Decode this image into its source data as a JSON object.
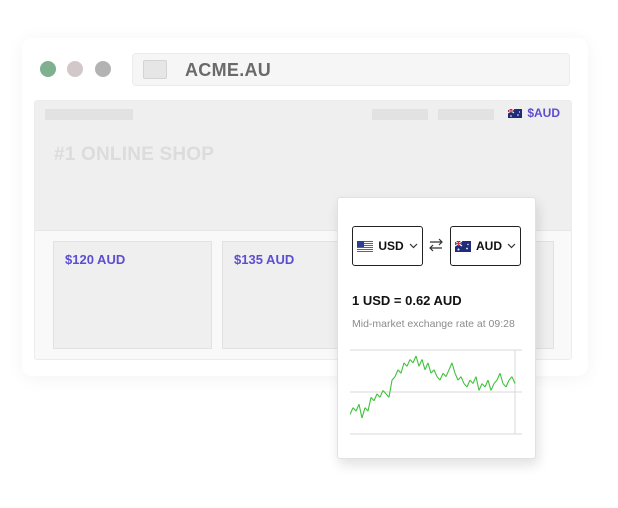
{
  "browser": {
    "url": "ACME.AU",
    "window_controls": [
      "close",
      "minimize",
      "maximize"
    ]
  },
  "site": {
    "currency_badge": "$AUD",
    "currency_badge_flag": "australia-flag-icon",
    "title": "#1 ONLINE SHOP",
    "products": [
      {
        "price": "$120 AUD"
      },
      {
        "price": "$135 AUD"
      },
      {
        "price": ""
      }
    ]
  },
  "converter": {
    "from": {
      "code": "USD",
      "flag": "us-flag-icon"
    },
    "to": {
      "code": "AUD",
      "flag": "australia-flag-icon"
    },
    "swap_icon": "swap-arrows-icon",
    "rate": "1 USD = 0.62 AUD",
    "note": "Mid-market exchange rate at 09:28",
    "chart_data": {
      "type": "line",
      "color": "#3ec23b",
      "values": [
        0.611,
        0.613,
        0.612,
        0.614,
        0.61,
        0.613,
        0.612,
        0.616,
        0.615,
        0.617,
        0.616,
        0.618,
        0.617,
        0.616,
        0.621,
        0.622,
        0.624,
        0.623,
        0.626,
        0.625,
        0.627,
        0.626,
        0.628,
        0.625,
        0.627,
        0.624,
        0.626,
        0.623,
        0.624,
        0.622,
        0.621,
        0.623,
        0.622,
        0.624,
        0.626,
        0.623,
        0.621,
        0.622,
        0.62,
        0.619,
        0.621,
        0.62,
        0.622,
        0.618,
        0.62,
        0.619,
        0.621,
        0.618,
        0.62,
        0.621,
        0.623,
        0.62,
        0.619,
        0.621,
        0.622,
        0.62
      ]
    }
  }
}
